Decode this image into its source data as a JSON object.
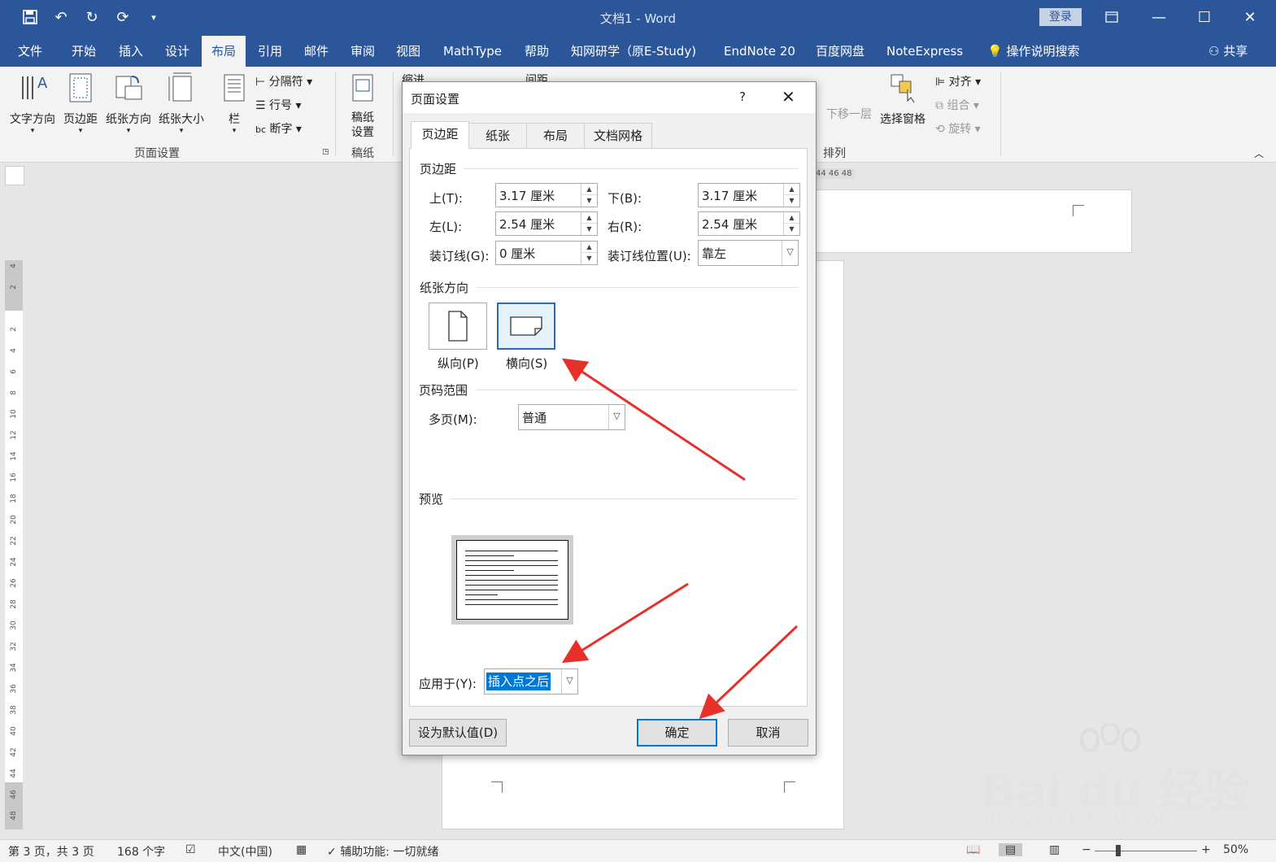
{
  "window": {
    "title": "文档1 - Word",
    "login_label": "登录"
  },
  "menu": {
    "tabs": [
      "文件",
      "开始",
      "插入",
      "设计",
      "布局",
      "引用",
      "邮件",
      "审阅",
      "视图",
      "MathType",
      "帮助",
      "知网研学（原E-Study)",
      "EndNote 20",
      "百度网盘",
      "NoteExpress"
    ],
    "active_tab": "布局",
    "tell_me": "操作说明搜索",
    "share": "共享"
  },
  "ribbon": {
    "text_direction": "文字方向",
    "margins": "页边距",
    "orientation": "纸张方向",
    "size": "纸张大小",
    "columns": "栏",
    "breaks": "分隔符",
    "line_numbers": "行号",
    "hyphenation": "断字",
    "page_setup_group": "页面设置",
    "draft_paper": "稿纸\n设置",
    "draft_group": "稿纸",
    "indent": "缩进",
    "spacing": "间距",
    "send_backward": "下移一层",
    "selection_pane": "选择窗格",
    "align": "对齐",
    "group": "组合",
    "rotate": "旋转",
    "arrange_group": "排列"
  },
  "ruler": {
    "horizontal_labels": "44 46 48",
    "vertical_ticks": [
      "4",
      "2",
      "2",
      "4",
      "6",
      "8",
      "10",
      "12",
      "14",
      "16",
      "18",
      "20",
      "22",
      "24",
      "26",
      "28",
      "30",
      "32",
      "34",
      "36",
      "38",
      "40",
      "42",
      "44",
      "46",
      "48"
    ]
  },
  "dialog": {
    "title": "页面设置",
    "help": "?",
    "tabs": [
      "页边距",
      "纸张",
      "布局",
      "文档网格"
    ],
    "active_tab": "页边距",
    "margins_section": "页边距",
    "top_label": "上(T):",
    "top_value": "3.17 厘米",
    "bottom_label": "下(B):",
    "bottom_value": "3.17 厘米",
    "left_label": "左(L):",
    "left_value": "2.54 厘米",
    "right_label": "右(R):",
    "right_value": "2.54 厘米",
    "gutter_label": "装订线(G):",
    "gutter_value": "0 厘米",
    "gutter_pos_label": "装订线位置(U):",
    "gutter_pos_value": "靠左",
    "orientation_section": "纸张方向",
    "portrait_label": "纵向(P)",
    "landscape_label": "横向(S)",
    "selected_orientation": "landscape",
    "pages_section": "页码范围",
    "multiple_pages_label": "多页(M):",
    "multiple_pages_value": "普通",
    "preview_section": "预览",
    "apply_to_label": "应用于(Y):",
    "apply_to_value": "插入点之后",
    "set_default_button": "设为默认值(D)",
    "ok_button": "确定",
    "cancel_button": "取消"
  },
  "status": {
    "page": "第 3 页，共 3 页",
    "words": "168 个字",
    "language": "中文(中国)",
    "accessibility": "辅助功能: 一切就绪",
    "zoom": "50%"
  },
  "watermark": {
    "brand": "Bai du 经验",
    "url": "jingyan.baidu.com"
  },
  "colors": {
    "title_bar": "#2b579a",
    "accent": "#0078d7",
    "annotation_arrow": "#e8302b"
  }
}
